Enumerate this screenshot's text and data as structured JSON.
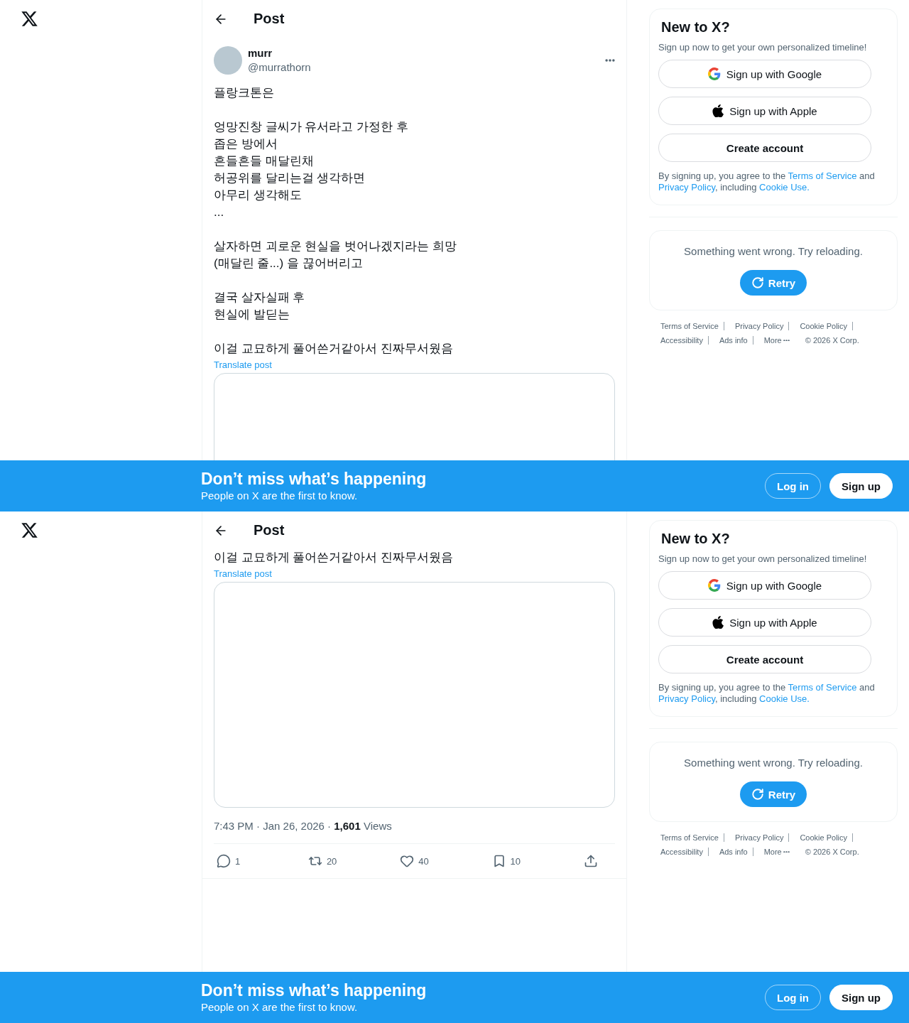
{
  "views": [
    {
      "header": {
        "title": "Post"
      },
      "post": {
        "author": {
          "name": "murr",
          "handle": "@murrathorn"
        },
        "paragraphs": [
          [
            "플랑크톤은"
          ],
          [
            "엉망진창 글씨가 유서라고 가정한 후",
            "좁은 방에서",
            "흔들흔들 매달린채",
            "허공위를 달리는걸 생각하면",
            "아무리 생각해도",
            "..."
          ],
          [
            "살자하면 괴로운 현실을 벗어나겠지라는 희망",
            "(매달린 줄...) 을 끊어버리고"
          ],
          [
            "결국 살자실패 후",
            "현실에 발딛는"
          ],
          [
            "이걸 교묘하게 풀어쓴거같아서 진짜무서웠음"
          ]
        ],
        "translate": "Translate post"
      },
      "sidebar": {
        "signup": {
          "title": "New to X?",
          "subtitle": "Sign up now to get your own personalized timeline!",
          "buttons": [
            {
              "kind": "google",
              "label": "Sign up with Google"
            },
            {
              "kind": "apple",
              "label": "Sign up with Apple"
            },
            {
              "kind": "create",
              "label": "Create account"
            }
          ],
          "legal": [
            {
              "text": "By signing up, you agree to the ",
              "link": false
            },
            {
              "text": "Terms of Service",
              "link": true
            },
            {
              "text": " and ",
              "link": false
            },
            {
              "text": "Privacy Policy",
              "link": true
            },
            {
              "text": ", including ",
              "link": false
            },
            {
              "text": "Cookie Use.",
              "link": true
            }
          ]
        },
        "error": {
          "message": "Something went wrong. Try reloading.",
          "retry": "Retry"
        },
        "footer": [
          [
            "Terms of Service",
            "Privacy Policy",
            "Cookie Policy"
          ],
          [
            "Accessibility",
            "Ads info",
            "More"
          ]
        ],
        "copyright": "© 2026 X Corp."
      },
      "banner": {
        "title": "Don’t miss what’s happening",
        "subtitle": "People on X are the first to know.",
        "login": "Log in",
        "signup": "Sign up"
      }
    },
    {
      "header": {
        "title": "Post"
      },
      "post": {
        "paragraphs": [
          [
            "이걸 교묘하게 풀어쓴거같아서 진짜무서웠음"
          ]
        ],
        "translate": "Translate post",
        "meta": "7:43 PM · Jan 26, 2026 · **1,601** Views",
        "actions": [
          {
            "kind": "reply",
            "count": "1"
          },
          {
            "kind": "repost",
            "count": "20"
          },
          {
            "kind": "like",
            "count": "40"
          },
          {
            "kind": "bookmark",
            "count": "10"
          },
          {
            "kind": "share"
          }
        ]
      },
      "sidebar": {
        "signup": {
          "title": "New to X?",
          "subtitle": "Sign up now to get your own personalized timeline!",
          "buttons": [
            {
              "kind": "google",
              "label": "Sign up with Google"
            },
            {
              "kind": "apple",
              "label": "Sign up with Apple"
            },
            {
              "kind": "create",
              "label": "Create account"
            }
          ],
          "legal": [
            {
              "text": "By signing up, you agree to the ",
              "link": false
            },
            {
              "text": "Terms of Service",
              "link": true
            },
            {
              "text": " and ",
              "link": false
            },
            {
              "text": "Privacy Policy",
              "link": true
            },
            {
              "text": ", including ",
              "link": false
            },
            {
              "text": "Cookie Use.",
              "link": true
            }
          ]
        },
        "error": {
          "message": "Something went wrong. Try reloading.",
          "retry": "Retry"
        },
        "footer": [
          [
            "Terms of Service",
            "Privacy Policy",
            "Cookie Policy"
          ],
          [
            "Accessibility",
            "Ads info",
            "More"
          ]
        ],
        "copyright": "© 2026 X Corp."
      },
      "banner": {
        "title": "Don’t miss what’s happening",
        "subtitle": "People on X are the first to know.",
        "login": "Log in",
        "signup": "Sign up"
      }
    }
  ]
}
